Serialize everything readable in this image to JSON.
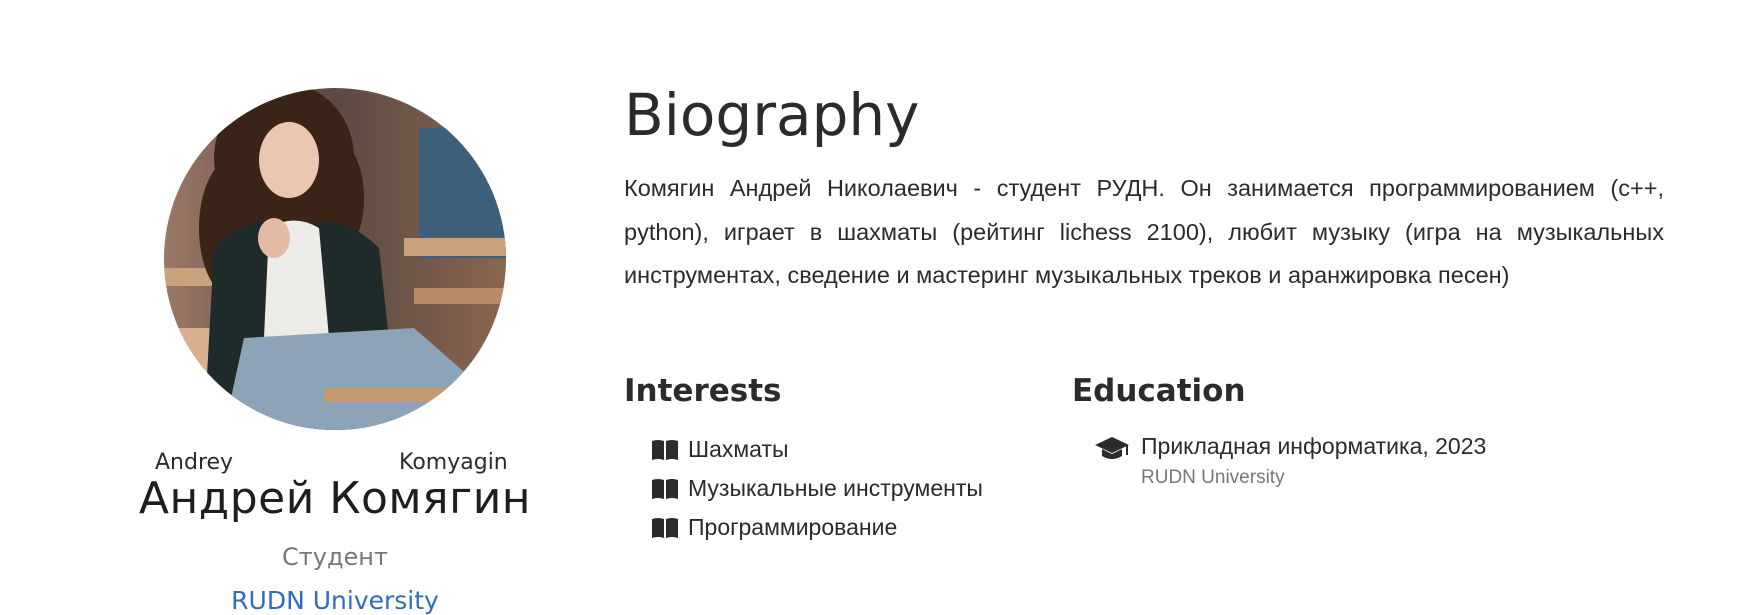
{
  "profile": {
    "first_name": "Andrey",
    "last_name": "Komyagin",
    "full_name": "Андрей Комягин",
    "role": "Студент",
    "organization": "RUDN University"
  },
  "biography": {
    "title": "Biography",
    "text": "Комягин Андрей Николаевич - студент РУДН. Он занимается программированием (c++, python), играет в шахматы (рейтинг lichess 2100), любит музыку (игра на музыкальных инструментах, сведение и мастеринг музыкальных треков и аранжировка песен)"
  },
  "interests": {
    "title": "Interests",
    "items": [
      {
        "label": "Шахматы",
        "icon": "book-icon"
      },
      {
        "label": "Музыкальные инструменты",
        "icon": "book-icon"
      },
      {
        "label": "Программирование",
        "icon": "book-icon"
      }
    ]
  },
  "education": {
    "title": "Education",
    "items": [
      {
        "course": "Прикладная информатика, 2023",
        "institution": "RUDN University",
        "icon": "graduation-cap-icon"
      }
    ]
  },
  "colors": {
    "text": "#2b2b2b",
    "muted": "#777777",
    "link": "#2f6cc0"
  }
}
